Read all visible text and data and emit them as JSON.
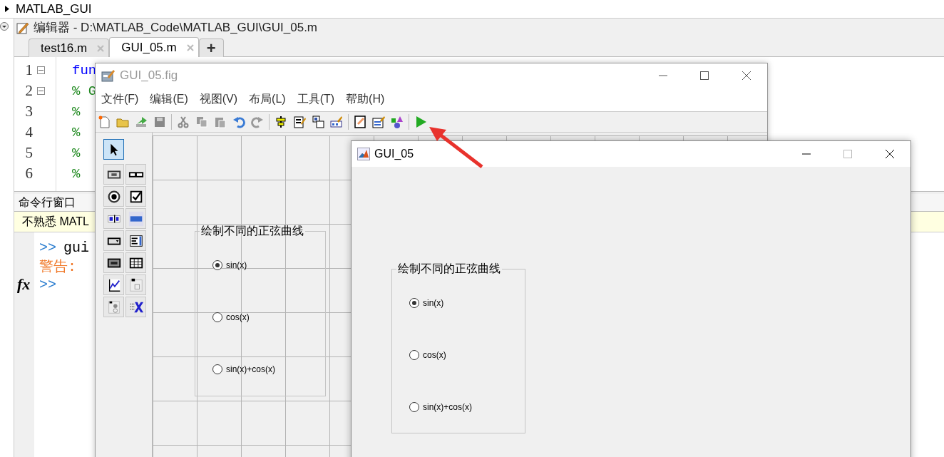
{
  "folder_bar": {
    "label": "MATLAB_GUI"
  },
  "editor": {
    "title": "编辑器 - D:\\MATLAB_Code\\MATLAB_GUI\\GUI_05.m",
    "tabs": [
      {
        "label": "test16.m",
        "selected": false
      },
      {
        "label": "GUI_05.m",
        "selected": true
      }
    ],
    "new_tab": "+",
    "lines": [
      {
        "number": "1",
        "code": "fun",
        "kind": "keyword",
        "fold": true
      },
      {
        "number": "2",
        "code": "% G",
        "kind": "comment",
        "fold": true
      },
      {
        "number": "3",
        "code": "%",
        "kind": "comment",
        "fold": false
      },
      {
        "number": "4",
        "code": "%",
        "kind": "comment",
        "fold": false
      },
      {
        "number": "5",
        "code": "%",
        "kind": "comment",
        "fold": false
      },
      {
        "number": "6",
        "code": "%",
        "kind": "comment",
        "fold": false
      }
    ]
  },
  "command_window": {
    "title": "命令行窗口",
    "notice": "不熟悉 MATL",
    "function_button": "fx",
    "lines": [
      {
        "kind": "input",
        "prompt": ">>",
        "text": "gui"
      },
      {
        "kind": "warning",
        "text": "警告:"
      },
      {
        "kind": "prompt",
        "prompt": ">>"
      }
    ]
  },
  "guide": {
    "title": "GUI_05.fig",
    "menu": [
      "文件(F)",
      "编辑(E)",
      "视图(V)",
      "布局(L)",
      "工具(T)",
      "帮助(H)"
    ],
    "palette": [
      {
        "selected": true
      },
      {
        "selected": false
      },
      {
        "selected": false
      },
      {
        "selected": false
      },
      {
        "selected": false
      },
      {
        "selected": false
      },
      {
        "selected": false
      },
      {
        "selected": false
      },
      {
        "selected": false
      },
      {
        "selected": false
      },
      {
        "selected": false
      },
      {
        "selected": false
      },
      {
        "selected": false
      },
      {
        "selected": false
      },
      {
        "selected": false
      }
    ],
    "panel": {
      "title": "绘制不同的正弦曲线",
      "options": [
        {
          "label": "sin(x)",
          "selected": true
        },
        {
          "label": "cos(x)",
          "selected": false
        },
        {
          "label": "sin(x)+cos(x)",
          "selected": false
        }
      ]
    }
  },
  "figure": {
    "title": "GUI_05",
    "panel": {
      "title": "绘制不同的正弦曲线",
      "options": [
        {
          "label": "sin(x)",
          "selected": true
        },
        {
          "label": "cos(x)",
          "selected": false
        },
        {
          "label": "sin(x)+cos(x)",
          "selected": false
        }
      ]
    }
  }
}
